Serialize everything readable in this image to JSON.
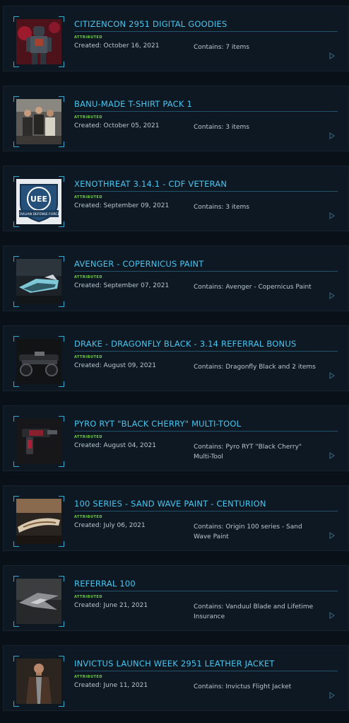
{
  "pledges": [
    {
      "title": "CITIZENCON 2951 DIGITAL GOODIES",
      "status": "ATTRIBUTED",
      "created": "Created: October 16, 2021",
      "contains": "Contains: 7 items",
      "thumb_icon": "citizencon-armor-thumbnail"
    },
    {
      "title": "BANU-MADE T-SHIRT PACK 1",
      "status": "ATTRIBUTED",
      "created": "Created: October 05, 2021",
      "contains": "Contains: 3 items",
      "thumb_icon": "tshirt-pack-thumbnail"
    },
    {
      "title": "XENOTHREAT 3.14.1 - CDF VETERAN",
      "status": "ATTRIBUTED",
      "created": "Created: September 09, 2021",
      "contains": "Contains: 3 items",
      "thumb_icon": "civilian-defense-force-badge"
    },
    {
      "title": "AVENGER - COPERNICUS PAINT",
      "status": "ATTRIBUTED",
      "created": "Created: September 07, 2021",
      "contains": "Contains: Avenger - Copernicus Paint",
      "thumb_icon": "avenger-ship-thumbnail"
    },
    {
      "title": "DRAKE - DRAGONFLY BLACK - 3.14 REFERRAL BONUS",
      "status": "ATTRIBUTED",
      "created": "Created: August 09, 2021",
      "contains": "Contains: Dragonfly Black and 2 items",
      "thumb_icon": "dragonfly-bike-thumbnail"
    },
    {
      "title": "PYRO RYT \"BLACK CHERRY\" MULTI-TOOL",
      "status": "ATTRIBUTED",
      "created": "Created: August 04, 2021",
      "contains": "Contains: Pyro RYT \"Black Cherry\" Multi-Tool",
      "thumb_icon": "multitool-thumbnail"
    },
    {
      "title": "100 SERIES - SAND WAVE PAINT - CENTURION",
      "status": "ATTRIBUTED",
      "created": "Created: July 06, 2021",
      "contains": "Contains: Origin 100 series - Sand Wave Paint",
      "thumb_icon": "origin-100-ship-thumbnail"
    },
    {
      "title": "REFERRAL 100",
      "status": "ATTRIBUTED",
      "created": "Created: June 21, 2021",
      "contains": "Contains: Vanduul Blade and Lifetime Insurance",
      "thumb_icon": "vanduul-blade-thumbnail"
    },
    {
      "title": "INVICTUS LAUNCH WEEK 2951 LEATHER JACKET",
      "status": "ATTRIBUTED",
      "created": "Created: June 11, 2021",
      "contains": "Contains: Invictus Flight Jacket",
      "thumb_icon": "leather-jacket-thumbnail"
    }
  ],
  "thumb_badge": {
    "text": "UEE",
    "arc": "CIVILIAN DEFENSE FORCE"
  },
  "colors": {
    "background": "#0a1018",
    "card": "#0e1823",
    "title": "#48c4ee",
    "status": "#6fd043",
    "text": "#b9c6cf",
    "accent": "#3aa8cc"
  }
}
